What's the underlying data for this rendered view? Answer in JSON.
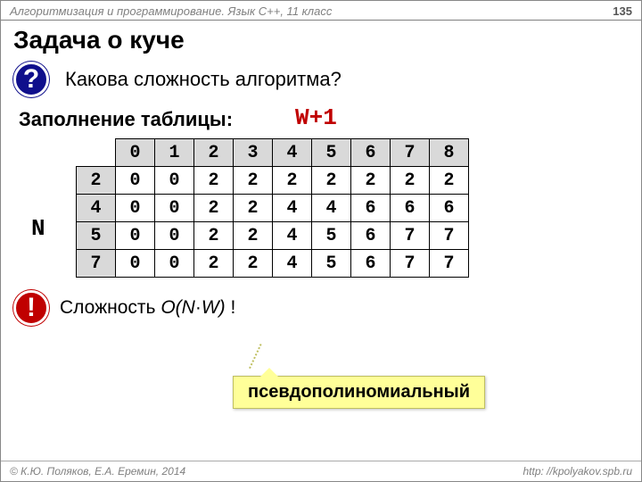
{
  "header": {
    "course": "Алгоритмизация и программирование. Язык C++, 11 класс",
    "page": "135"
  },
  "title": "Задача о куче",
  "question": {
    "badge": "?",
    "text": "Какова сложность алгоритма?"
  },
  "subtitle": "Заполнение таблицы:",
  "labels": {
    "N": "N",
    "W": "W+1"
  },
  "exclaim": {
    "badge": "!",
    "prefix": "Сложность ",
    "formula_open": "O(N",
    "dot": "·",
    "formula_close": "W)",
    "suffix": " !"
  },
  "callout": "псевдополиномиальный",
  "footer": {
    "left": "© К.Ю. Поляков, Е.А. Еремин, 2014",
    "right": "http: //kpolyakov.spb.ru"
  },
  "chart_data": {
    "type": "table",
    "col_headers": [
      "0",
      "1",
      "2",
      "3",
      "4",
      "5",
      "6",
      "7",
      "8"
    ],
    "row_headers": [
      "2",
      "4",
      "5",
      "7"
    ],
    "rows": [
      [
        "0",
        "0",
        "2",
        "2",
        "2",
        "2",
        "2",
        "2",
        "2"
      ],
      [
        "0",
        "0",
        "2",
        "2",
        "4",
        "4",
        "6",
        "6",
        "6"
      ],
      [
        "0",
        "0",
        "2",
        "2",
        "4",
        "5",
        "6",
        "7",
        "7"
      ],
      [
        "0",
        "0",
        "2",
        "2",
        "4",
        "5",
        "6",
        "7",
        "7"
      ]
    ]
  }
}
